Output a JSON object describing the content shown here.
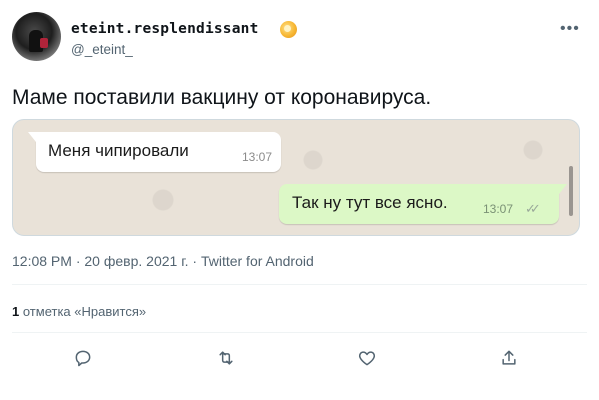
{
  "author": {
    "display_name": "eteint.resplendissant",
    "handle": "@_eteint_"
  },
  "tweet": {
    "text": "Маме поставили вакцину от коронавируса."
  },
  "chat": {
    "incoming": {
      "text": "Меня чипировали",
      "time": "13:07"
    },
    "outgoing": {
      "text": "Так ну тут все ясно.",
      "time": "13:07",
      "status": "read"
    }
  },
  "meta": {
    "time": "12:08 PM",
    "date": "20 февр. 2021 г.",
    "source": "Twitter for Android",
    "separator": "·"
  },
  "stats": {
    "likes_count": "1",
    "likes_label": "отметка «Нравится»"
  },
  "actions": {
    "reply_icon": "speech-bubble-icon",
    "retweet_icon": "retweet-icon",
    "like_icon": "heart-icon",
    "share_icon": "share-icon",
    "more_icon": "more-dots-icon"
  }
}
